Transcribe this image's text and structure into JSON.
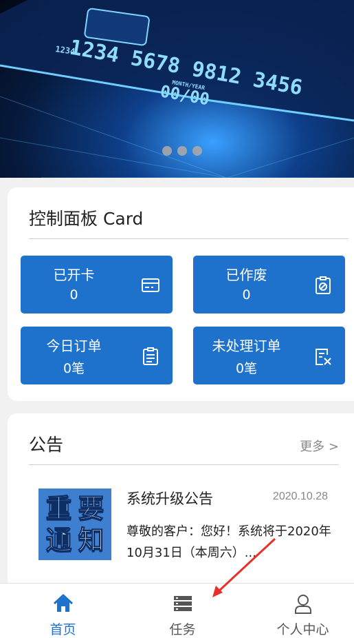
{
  "banner": {
    "card_numbers": {
      "main": "1234 5678 9812 3456",
      "small": "1234",
      "expiry_label": "MONTH/YEAR",
      "expiry": "00/00"
    },
    "carousel_dots": 3
  },
  "dashboard": {
    "title": "控制面板 Card",
    "tiles": [
      {
        "label": "已开卡",
        "value": "0",
        "icon": "card-icon"
      },
      {
        "label": "已作废",
        "value": "0",
        "icon": "cancel-clipboard-icon"
      },
      {
        "label": "今日订单",
        "value": "0笔",
        "icon": "clipboard-list-icon"
      },
      {
        "label": "未处理订单",
        "value": "0笔",
        "icon": "pending-order-icon"
      }
    ]
  },
  "notice": {
    "title": "公告",
    "more": "更多 >",
    "item": {
      "image_text": [
        "重",
        "要",
        "通",
        "知"
      ],
      "title": "系统升级公告",
      "date": "2020.10.28",
      "body": "尊敬的客户：您好！系统将于2020年10月31日（本周六）..."
    }
  },
  "tabbar": {
    "items": [
      {
        "label": "首页",
        "icon": "home-icon",
        "active": true
      },
      {
        "label": "任务",
        "icon": "server-list-icon",
        "active": false
      },
      {
        "label": "个人中心",
        "icon": "user-icon",
        "active": false
      }
    ]
  },
  "colors": {
    "accent": "#1f72cc",
    "annotation_arrow": "#e8302a"
  }
}
